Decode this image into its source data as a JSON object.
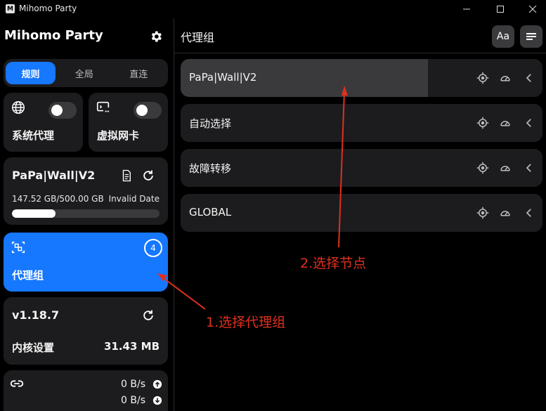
{
  "window": {
    "title": "Mihomo Party",
    "logo_letter": "M"
  },
  "sidebar": {
    "brand": "Mihomo Party",
    "modes": [
      {
        "label": "规则",
        "active": true
      },
      {
        "label": "全局",
        "active": false
      },
      {
        "label": "直连",
        "active": false
      }
    ],
    "toggles": [
      {
        "label": "系统代理",
        "icon": "globe-icon",
        "on": false
      },
      {
        "label": "虚拟网卡",
        "icon": "tun-icon",
        "on": false
      }
    ],
    "subscription": {
      "name": "PaPa|Wall|V2",
      "usage": "147.52 GB/500.00 GB",
      "expire": "Invalid Date",
      "progress_fraction": 0.295
    },
    "proxy_groups": {
      "label": "代理组",
      "count": "4"
    },
    "core": {
      "version": "v1.18.7",
      "label": "内核设置",
      "memory": "31.43 MB"
    },
    "traffic": {
      "up": "0 B/s",
      "down": "0 B/s"
    }
  },
  "main": {
    "title": "代理组",
    "font_button": "Aa",
    "groups": [
      {
        "name": "PaPa|Wall|V2",
        "selected": true
      },
      {
        "name": "自动选择",
        "selected": false
      },
      {
        "name": "故障转移",
        "selected": false
      },
      {
        "name": "GLOBAL",
        "selected": false
      }
    ]
  },
  "annotations": {
    "step1": "1.选择代理组",
    "step2": "2.选择节点",
    "color": "#e0301e"
  },
  "colors": {
    "accent": "#1677ff",
    "card": "#1c1c1e",
    "background": "#000000"
  }
}
